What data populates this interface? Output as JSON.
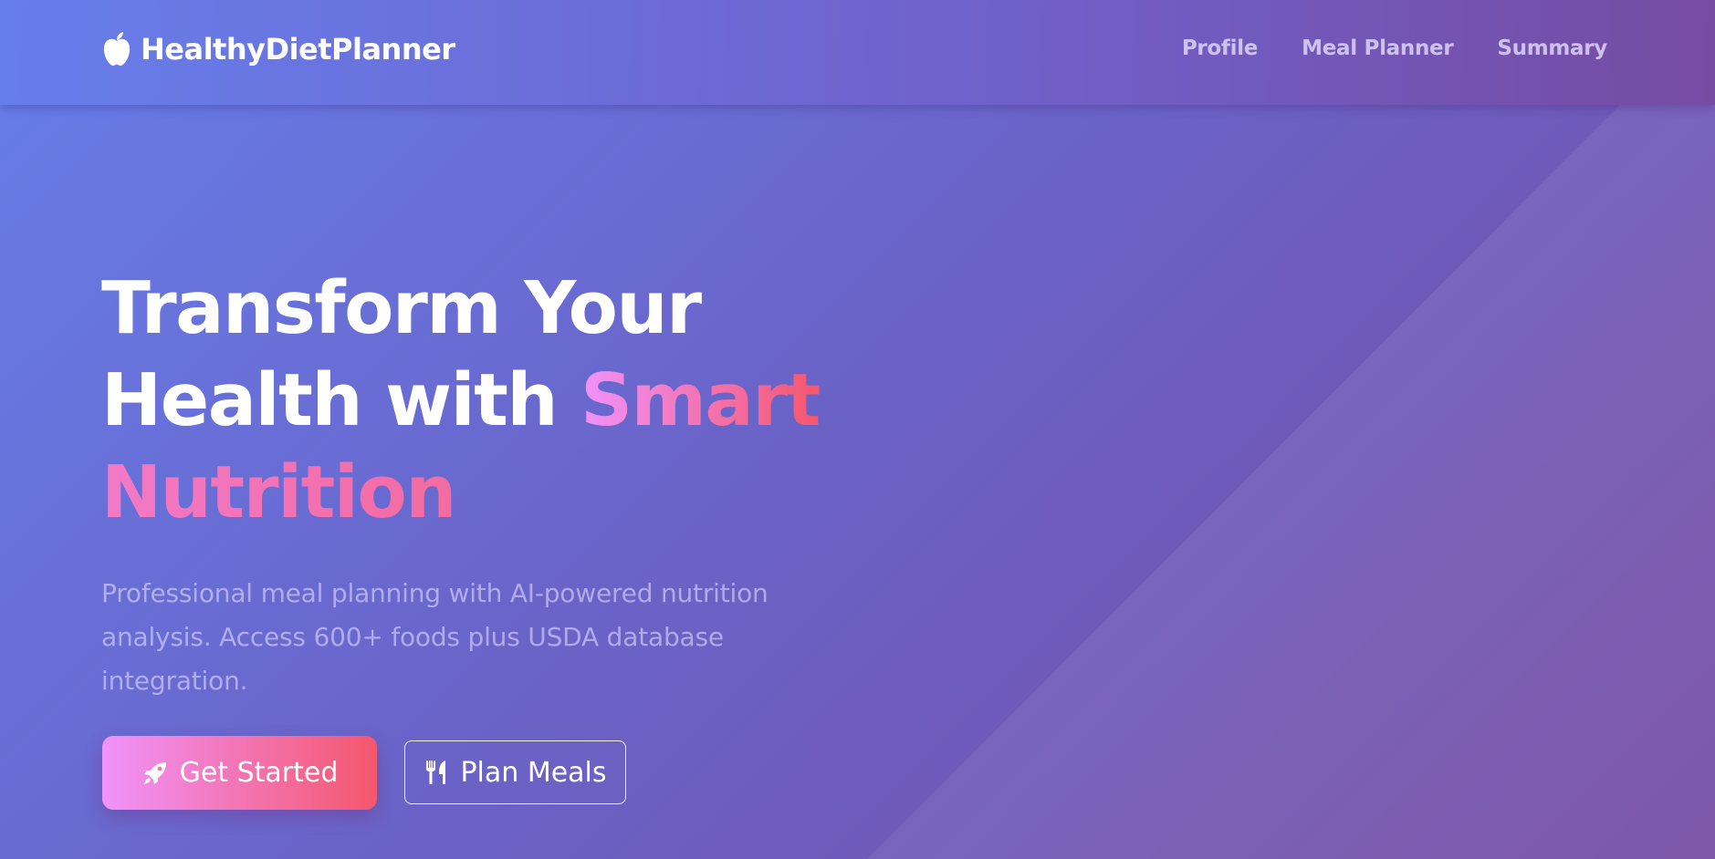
{
  "brand": {
    "name": "HealthyDietPlanner",
    "logo_icon": "apple-icon"
  },
  "nav": {
    "links": [
      "Profile",
      "Meal Planner",
      "Summary"
    ]
  },
  "hero": {
    "title_line1": "Transform Your",
    "title_line2_plain": "Health with ",
    "title_line2_accent": "Smart",
    "title_line3_accent": "Nutrition",
    "subtitle": "Professional meal planning with AI-powered nutrition analysis. Access 600+ foods plus USDA database integration.",
    "primary_button": {
      "label": "Get Started",
      "icon": "rocket-icon"
    },
    "secondary_button": {
      "label": "Plan Meals",
      "icon": "utensils-icon"
    }
  },
  "colors": {
    "background_start": "#667eea",
    "background_end": "#764ba2",
    "accent_start": "#f093fb",
    "accent_end": "#f5576c"
  }
}
